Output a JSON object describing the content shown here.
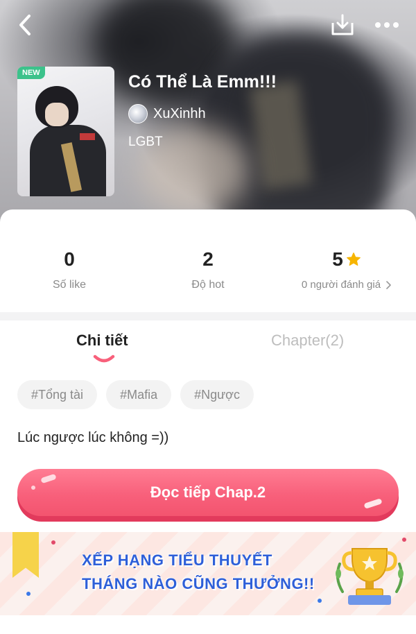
{
  "header": {
    "back_icon": "chevron-left-icon",
    "download_icon": "download-icon",
    "more_icon": "more-horizontal-icon"
  },
  "story": {
    "badge": "NEW",
    "title": "Có Thể Là Emm!!!",
    "author": "XuXinhh",
    "genre": "LGBT"
  },
  "stats": {
    "likes_value": "0",
    "likes_label": "Số like",
    "hot_value": "2",
    "hot_label": "Độ hot",
    "rating_value": "5",
    "rating_label": "0 người đánh giá"
  },
  "tabs": {
    "details": "Chi tiết",
    "chapters": "Chapter(2)"
  },
  "tags": [
    "#Tổng tài",
    "#Mafia",
    "#Ngược"
  ],
  "description": "Lúc ngược lúc không =))",
  "cta": {
    "label": "Đọc tiếp Chap.2"
  },
  "banner": {
    "line1": "XẾP HẠNG TIỂU THUYẾT",
    "line2": "THÁNG NÀO CŨNG THƯỞNG!!"
  },
  "colors": {
    "accent": "#f8607b",
    "new_badge": "#3cc28b",
    "star": "#f7b500",
    "banner_text": "#2e5fd8"
  }
}
